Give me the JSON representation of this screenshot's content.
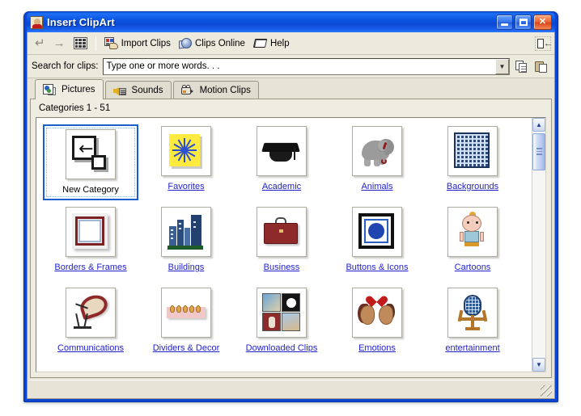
{
  "window": {
    "title": "Insert ClipArt",
    "icon": "clipart-app-icon",
    "caption_buttons": [
      {
        "name": "minimize",
        "label": "_"
      },
      {
        "name": "maximize",
        "label": "□"
      },
      {
        "name": "close",
        "label": "✕"
      }
    ]
  },
  "toolbar": {
    "back_label": "",
    "forward_label": "",
    "all_categories_label": "",
    "import_clips_label": "Import Clips",
    "clips_online_label": "Clips Online",
    "help_label": "Help",
    "dock_label": ""
  },
  "search": {
    "label": "Search for clips:",
    "value": "Type one or more words. . .",
    "placeholder": "Type one or more words. . .",
    "copy_label": "",
    "paste_label": ""
  },
  "tabs": [
    {
      "label": "Pictures",
      "icon": "pictures-icon",
      "active": true
    },
    {
      "label": "Sounds",
      "icon": "sounds-icon",
      "active": false
    },
    {
      "label": "Motion Clips",
      "icon": "motion-clips-icon",
      "active": false
    }
  ],
  "panel": {
    "category_count_label": "Categories 1 - 51"
  },
  "categories": [
    {
      "label": "New Category",
      "art": "new-category",
      "selected": true
    },
    {
      "label": "Favorites",
      "art": "favorites",
      "selected": false
    },
    {
      "label": "Academic",
      "art": "academic",
      "selected": false
    },
    {
      "label": "Animals",
      "art": "animals",
      "selected": false
    },
    {
      "label": "Backgrounds",
      "art": "backgrounds",
      "selected": false
    },
    {
      "label": "Borders & Frames",
      "art": "borders-frames",
      "selected": false
    },
    {
      "label": "Buildings",
      "art": "buildings",
      "selected": false
    },
    {
      "label": "Business",
      "art": "business",
      "selected": false
    },
    {
      "label": "Buttons & Icons",
      "art": "buttons-icons",
      "selected": false
    },
    {
      "label": "Cartoons",
      "art": "cartoons",
      "selected": false
    },
    {
      "label": "Communications",
      "art": "communications",
      "selected": false
    },
    {
      "label": "Dividers & Decor",
      "art": "dividers-decor",
      "selected": false
    },
    {
      "label": "Downloaded Clips",
      "art": "downloaded-clips",
      "selected": false
    },
    {
      "label": "Emotions",
      "art": "emotions",
      "selected": false
    },
    {
      "label": "entertainment",
      "art": "entertainment",
      "selected": false
    }
  ],
  "scrollbar": {
    "up_label": "▲",
    "down_label": "▼"
  },
  "colors": {
    "titlebar_blue": "#0a46d2",
    "link_blue": "#2222cc",
    "selection_blue": "#1a5fd0",
    "face": "#e7e4d7",
    "panel": "#efece1"
  }
}
